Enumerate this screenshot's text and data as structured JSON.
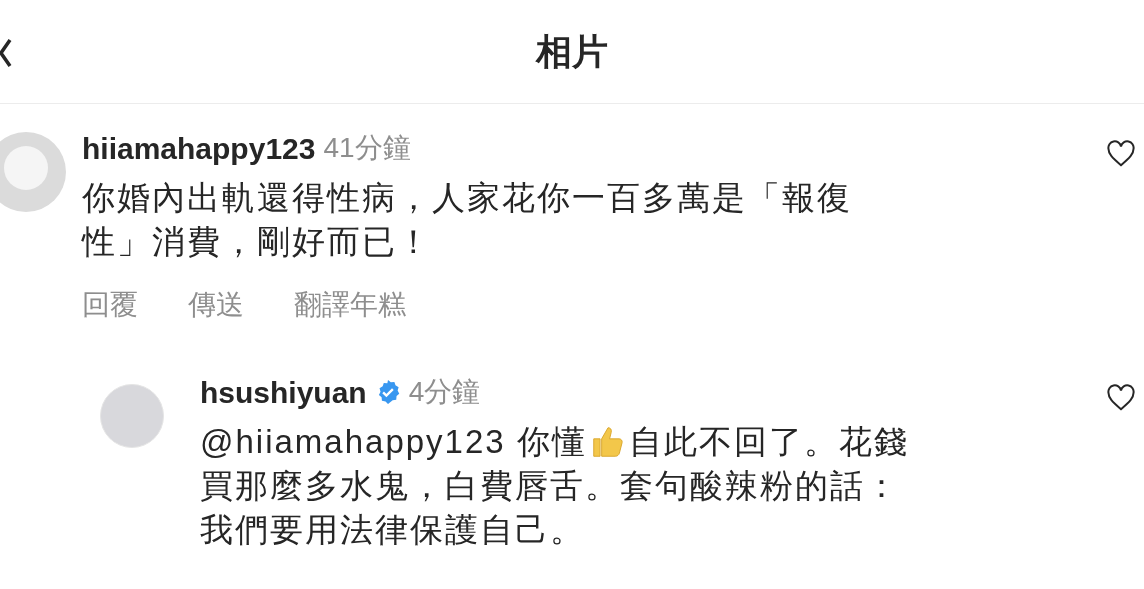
{
  "header": {
    "title": "相片"
  },
  "comments": [
    {
      "username": "hiiamahappy123",
      "verified": false,
      "time": "41分鐘",
      "liked": false,
      "kind": "default",
      "lines": [
        [
          {
            "kind": "text",
            "text": "你婚內出軌還得性病，人家花你一百多萬是「報復"
          }
        ],
        [
          {
            "kind": "text",
            "text": "性」消費，剛好而已！"
          }
        ]
      ],
      "actions": [
        "回覆",
        "傳送",
        "翻譯年糕"
      ]
    },
    {
      "username": "hsushiyuan",
      "verified": true,
      "time": "4分鐘",
      "liked": false,
      "kind": "photo",
      "lines": [
        [
          {
            "kind": "text",
            "text": "@hiiamahappy123 你懂"
          },
          {
            "kind": "emoji"
          },
          {
            "kind": "text",
            "text": "自此不回了。花錢"
          }
        ],
        [
          {
            "kind": "text",
            "text": "買那麼多水鬼，白費唇舌。套句酸辣粉的話："
          }
        ],
        [
          {
            "kind": "text",
            "text": "我們要用法律保護自己。"
          }
        ]
      ]
    }
  ]
}
